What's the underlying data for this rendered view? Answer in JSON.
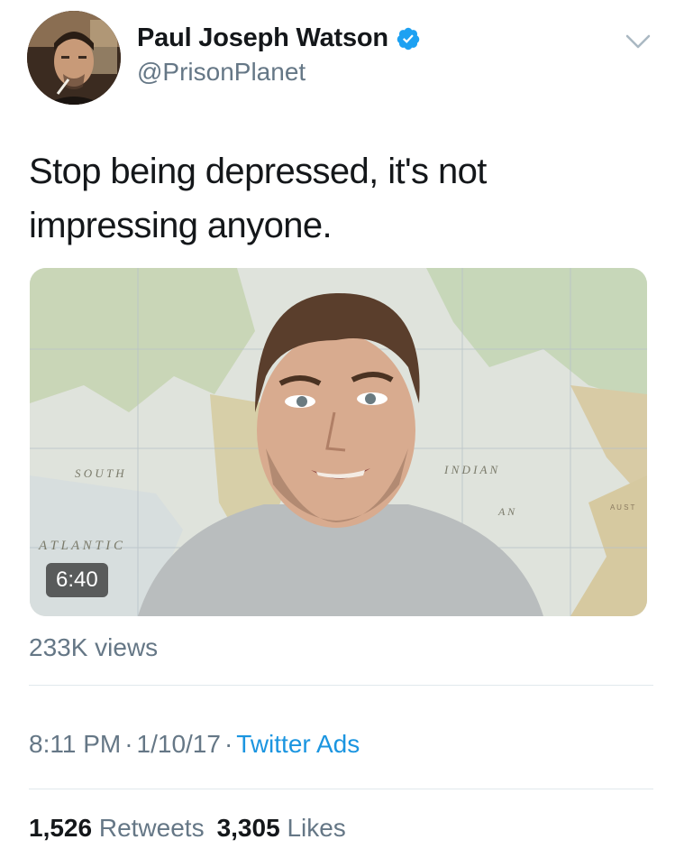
{
  "author": {
    "display_name": "Paul Joseph Watson",
    "handle": "@PrisonPlanet",
    "verified": true,
    "avatar_icon": "profile-photo",
    "verified_icon": "verified-badge-icon",
    "menu_icon": "chevron-down-icon"
  },
  "tweet": {
    "text": "Stop being depressed, it's not impressing anyone."
  },
  "video": {
    "duration": "6:40",
    "views": "233K views",
    "map_labels": [
      "S O U T H",
      "A T L A N T I C",
      "I N D I A N",
      "A N",
      "A U S T"
    ]
  },
  "meta": {
    "time": "8:11 PM",
    "separator": "·",
    "date": "1/10/17",
    "source": "Twitter Ads"
  },
  "stats": {
    "retweets_count": "1,526",
    "retweets_label": "Retweets",
    "likes_count": "3,305",
    "likes_label": "Likes"
  },
  "colors": {
    "text": "#14171a",
    "secondary": "#657786",
    "link": "#1b95e0",
    "divider": "#e1e8ed"
  }
}
